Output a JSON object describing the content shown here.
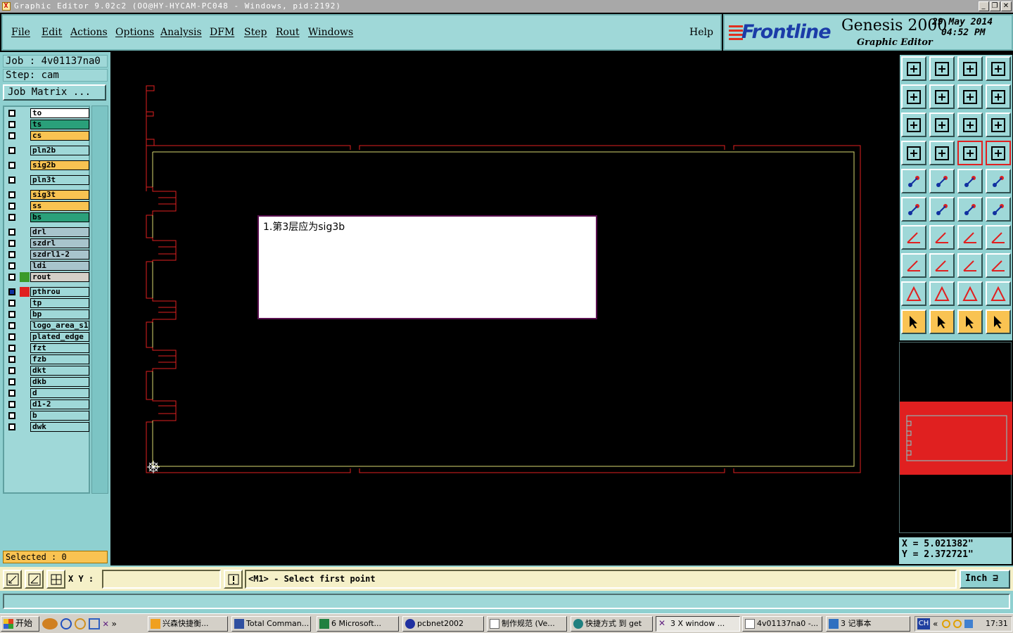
{
  "window": {
    "title": "Graphic Editor 9.02c2 (OO@HY-HYCAM-PC048 - Windows, pid:2192)",
    "min_label": "_",
    "restore_label": "❐",
    "close_label": "✕"
  },
  "menu": {
    "items": [
      "File",
      "Edit",
      "Actions",
      "Options",
      "Analysis",
      "DFM",
      "Step",
      "Rout",
      "Windows"
    ],
    "help": "Help"
  },
  "branding": {
    "logo": "Frontline",
    "product": "Genesis 2000",
    "subtitle": "Graphic Editor",
    "date": "29 May 2014",
    "time": "04:52 PM"
  },
  "job": {
    "job_label": "Job : 4v01137na0",
    "step_label": "Step: cam",
    "matrix_button": "Job Matrix ..."
  },
  "layers": [
    {
      "name": "to",
      "color": "#ffffff",
      "aux": ""
    },
    {
      "name": "ts",
      "color": "#2aa07a",
      "aux": ""
    },
    {
      "name": "cs",
      "color": "#f9c352",
      "aux": ""
    },
    {
      "name": "pln2b",
      "color": "#9fd8d8",
      "aux": ""
    },
    {
      "name": "sig2b",
      "color": "#f9c352",
      "aux": ""
    },
    {
      "name": "pln3t",
      "color": "#9fd8d8",
      "aux": ""
    },
    {
      "name": "sig3t",
      "color": "#f9c352",
      "aux": ""
    },
    {
      "name": "ss",
      "color": "#f9c352",
      "aux": ""
    },
    {
      "name": "bs",
      "color": "#2aa07a",
      "aux": ""
    },
    {
      "name": "drl",
      "color": "#a8c4cc",
      "aux": ""
    },
    {
      "name": "szdrl",
      "color": "#a8c4cc",
      "aux": ""
    },
    {
      "name": "szdrl1-2",
      "color": "#a8c4cc",
      "aux": ""
    },
    {
      "name": "ldi",
      "color": "#a8c4cc",
      "aux": ""
    },
    {
      "name": "rout",
      "color": "#d4d0c8",
      "aux": "#3a9a2a"
    },
    {
      "name": "pthrou",
      "color": "#9fd8d8",
      "aux": "#e02020"
    },
    {
      "name": "tp",
      "color": "#9fd8d8",
      "aux": ""
    },
    {
      "name": "bp",
      "color": "#9fd8d8",
      "aux": ""
    },
    {
      "name": "logo_area_s1",
      "color": "#9fd8d8",
      "aux": ""
    },
    {
      "name": "plated_edge",
      "color": "#9fd8d8",
      "aux": ""
    },
    {
      "name": "fzt",
      "color": "#9fd8d8",
      "aux": ""
    },
    {
      "name": "fzb",
      "color": "#9fd8d8",
      "aux": ""
    },
    {
      "name": "dkt",
      "color": "#9fd8d8",
      "aux": ""
    },
    {
      "name": "dkb",
      "color": "#9fd8d8",
      "aux": ""
    },
    {
      "name": "d",
      "color": "#9fd8d8",
      "aux": ""
    },
    {
      "name": "d1-2",
      "color": "#9fd8d8",
      "aux": ""
    },
    {
      "name": "b",
      "color": "#9fd8d8",
      "aux": ""
    },
    {
      "name": "dwk",
      "color": "#9fd8d8",
      "aux": ""
    }
  ],
  "selected": "Selected : 0",
  "note": {
    "text": "1.第3层应为sig3b"
  },
  "coords": {
    "x": "X = 5.021382\"",
    "y": "Y = 2.372721\""
  },
  "command": {
    "xy_label": "X Y :",
    "xy_value": "",
    "prompt": "<M1> - Select first point",
    "units": "Inch ⊒"
  },
  "taskbar": {
    "start": "开始",
    "tasks": [
      "兴森快捷衡...",
      "Total Comman...",
      "6 Microsoft...",
      "pcbnet2002",
      "制作规范 (Ve...",
      "快捷方式 到 get",
      "3 X window ...",
      "4v01137na0 -...",
      "3 记事本"
    ],
    "lang": "CH",
    "clock": "17:31"
  },
  "colors": {
    "panel": "#9fd8d8",
    "outline_red": "#e02020",
    "outline_yellow": "#d8d870",
    "selected_bg": "#f9c352"
  }
}
